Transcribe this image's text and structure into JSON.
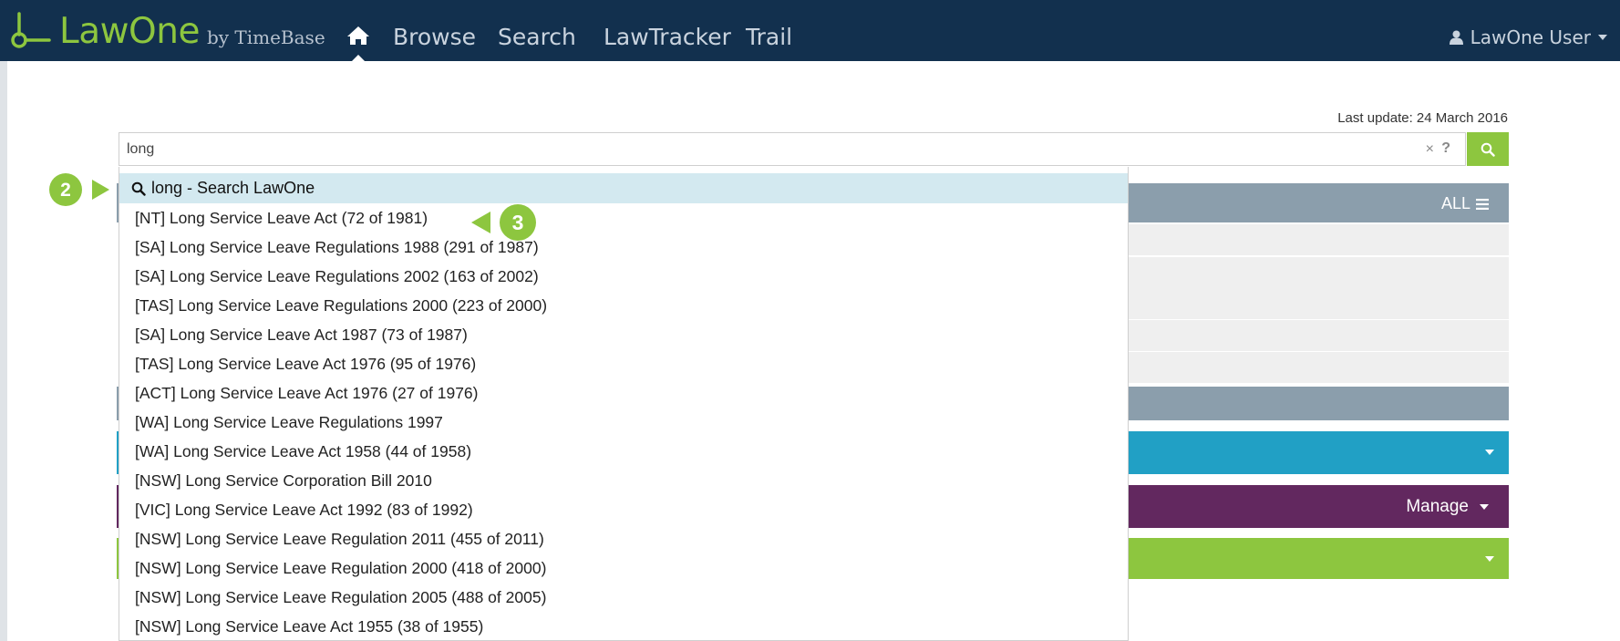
{
  "navbar": {
    "brand_name": "LawOne",
    "brand_by": "by TimeBase",
    "links": [
      "Browse",
      "Search",
      "LawTracker",
      "Trail"
    ],
    "user": "LawOne User",
    "colors": {
      "background": "#12304e",
      "brand": "#8dc63f"
    }
  },
  "search": {
    "last_update": "Last update: 24 March 2016",
    "query": "long",
    "clear_icon": "×",
    "help_icon": "?"
  },
  "dropdown": {
    "first_option": "long - Search LawOne",
    "items": [
      "[NT] Long Service Leave Act (72 of 1981)",
      "[SA] Long Service Leave Regulations 1988 (291 of 1987)",
      "[SA] Long Service Leave Regulations 2002 (163 of 2002)",
      "[TAS] Long Service Leave Regulations 2000 (223 of 2000)",
      "[SA] Long Service Leave Act 1987 (73 of 1987)",
      "[TAS] Long Service Leave Act 1976 (95 of 1976)",
      "[ACT] Long Service Leave Act 1976 (27 of 1976)",
      "[WA] Long Service Leave Regulations 1997",
      "[WA] Long Service Leave Act 1958 (44 of 1958)",
      "[NSW] Long Service Corporation Bill 2010",
      "[VIC] Long Service Leave Act 1992 (83 of 1992)",
      "[NSW] Long Service Leave Regulation 2011 (455 of 2011)",
      "[NSW] Long Service Leave Regulation 2000 (418 of 2000)",
      "[NSW] Long Service Leave Regulation 2005 (488 of 2005)",
      "[NSW] Long Service Leave Act 1955 (38 of 1955)"
    ]
  },
  "panels": {
    "all_label": "ALL",
    "manage_label": "Manage",
    "colors": {
      "grey": "#8b9eac",
      "teal": "#21a0c5",
      "purple": "#62285f",
      "green": "#8dc63f"
    }
  },
  "callouts": {
    "step_2": "2",
    "step_3": "3",
    "color": "#8dc63f"
  }
}
